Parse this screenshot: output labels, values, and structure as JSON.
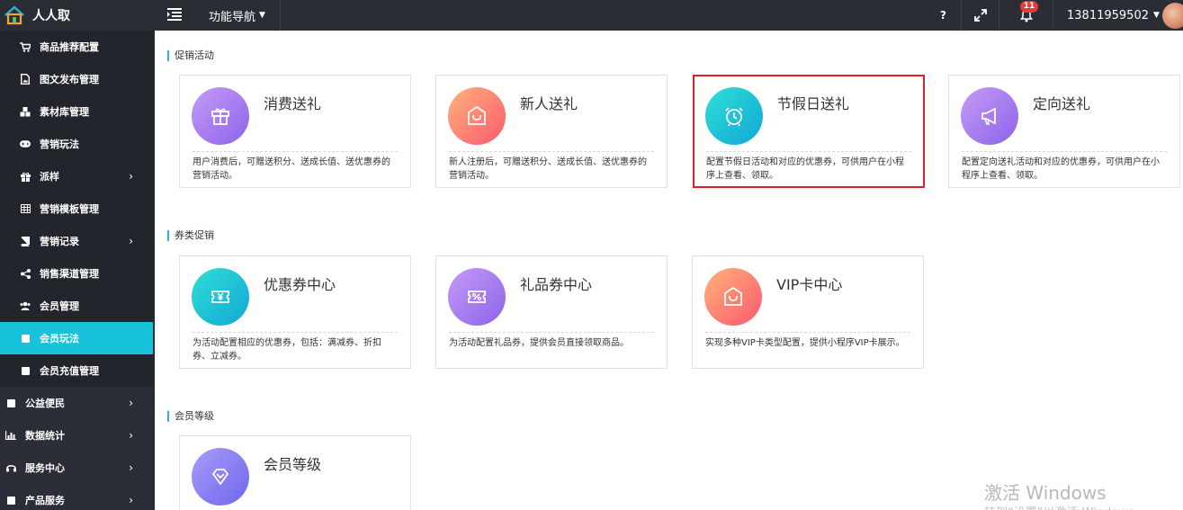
{
  "app": {
    "brand": "人人取"
  },
  "topbar": {
    "nav_dropdown": "功能导航",
    "help_label": "?",
    "notification_count": "11",
    "username": "13811959502"
  },
  "sidebar": {
    "items": [
      {
        "label": "商品推荐配置",
        "icon": "cart-icon"
      },
      {
        "label": "图文发布管理",
        "icon": "file-image-icon"
      },
      {
        "label": "素材库管理",
        "icon": "cubes-icon"
      },
      {
        "label": "营销玩法",
        "icon": "gamepad-icon"
      },
      {
        "label": "派样",
        "icon": "gift-icon"
      },
      {
        "label": "营销模板管理",
        "icon": "table-icon"
      },
      {
        "label": "营销记录",
        "icon": "book-icon"
      },
      {
        "label": "销售渠道管理",
        "icon": "share-icon"
      },
      {
        "label": "会员管理",
        "icon": "users-icon"
      },
      {
        "label": "会员玩法",
        "icon": "square-icon"
      },
      {
        "label": "会员充值管理",
        "icon": "square-icon"
      },
      {
        "label": "公益便民",
        "icon": "square-icon"
      },
      {
        "label": "数据统计",
        "icon": "bar-chart-icon"
      },
      {
        "label": "服务中心",
        "icon": "headset-icon"
      },
      {
        "label": "产品服务",
        "icon": "square-icon"
      }
    ],
    "active": "会员玩法"
  },
  "sections": [
    {
      "title": "促销活动",
      "cards": [
        {
          "title": "消费送礼",
          "desc": "用户消费后，可赠送积分、送成长值、送优惠券的营销活动。",
          "icon": "gift-icon"
        },
        {
          "title": "新人送礼",
          "desc": "新人注册后，可赠送积分、送成长值、送优惠券的营销活动。",
          "icon": "shop-bag-icon"
        },
        {
          "title": "节假日送礼",
          "desc": "配置节假日活动和对应的优惠券，可供用户在小程序上查看、领取。",
          "icon": "alarm-clock-icon"
        },
        {
          "title": "定向送礼",
          "desc": "配置定向送礼活动和对应的优惠券，可供用户在小程序上查看、领取。",
          "icon": "megaphone-icon"
        }
      ]
    },
    {
      "title": "券类促销",
      "cards": [
        {
          "title": "优惠券中心",
          "desc": "为活动配置相应的优惠券，包括：满减券、折扣券、立减券。",
          "icon": "yen-ticket-icon"
        },
        {
          "title": "礼品券中心",
          "desc": "为活动配置礼品券，提供会员直接领取商品。",
          "icon": "percent-ticket-icon"
        },
        {
          "title": "VIP卡中心",
          "desc": "实现多种VIP卡类型配置，提供小程序VIP卡展示。",
          "icon": "shop-bag-icon"
        }
      ]
    },
    {
      "title": "会员等级",
      "cards": [
        {
          "title": "会员等级",
          "desc": "",
          "icon": "diamond-icon"
        }
      ]
    }
  ],
  "selected_card": "节假日送礼",
  "watermark": {
    "line1": "激活 Windows",
    "line2": "转到“设置”以激活 Windows。"
  },
  "colors": {
    "topbar": "#2a2d33",
    "sidebar": "#2b2e36",
    "active_item": "#18c2d8",
    "selection_border": "#d9222a"
  }
}
